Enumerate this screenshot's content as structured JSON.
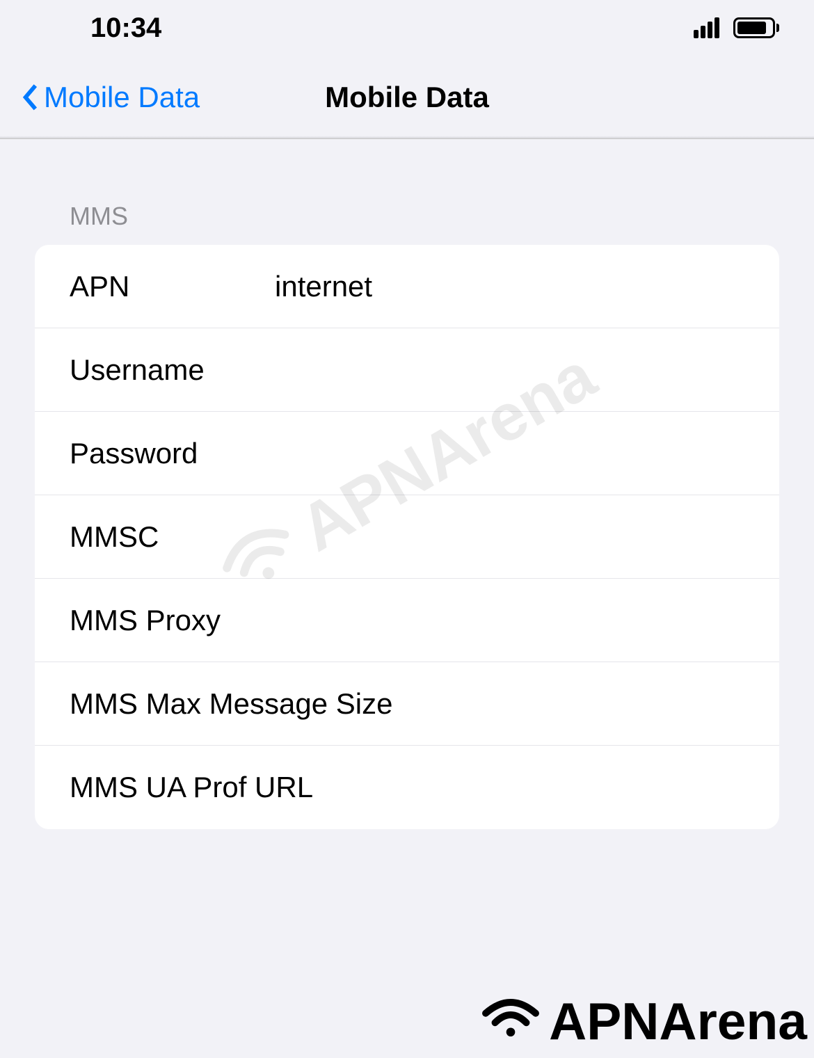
{
  "statusBar": {
    "time": "10:34"
  },
  "navigation": {
    "backLabel": "Mobile Data",
    "title": "Mobile Data"
  },
  "section": {
    "header": "MMS",
    "fields": {
      "apn": {
        "label": "APN",
        "value": "internet"
      },
      "username": {
        "label": "Username",
        "value": ""
      },
      "password": {
        "label": "Password",
        "value": ""
      },
      "mmsc": {
        "label": "MMSC",
        "value": ""
      },
      "mmsProxy": {
        "label": "MMS Proxy",
        "value": ""
      },
      "mmsMaxSize": {
        "label": "MMS Max Message Size",
        "value": ""
      },
      "mmsUaProf": {
        "label": "MMS UA Prof URL",
        "value": ""
      }
    }
  },
  "watermark": {
    "text": "APNArena"
  }
}
